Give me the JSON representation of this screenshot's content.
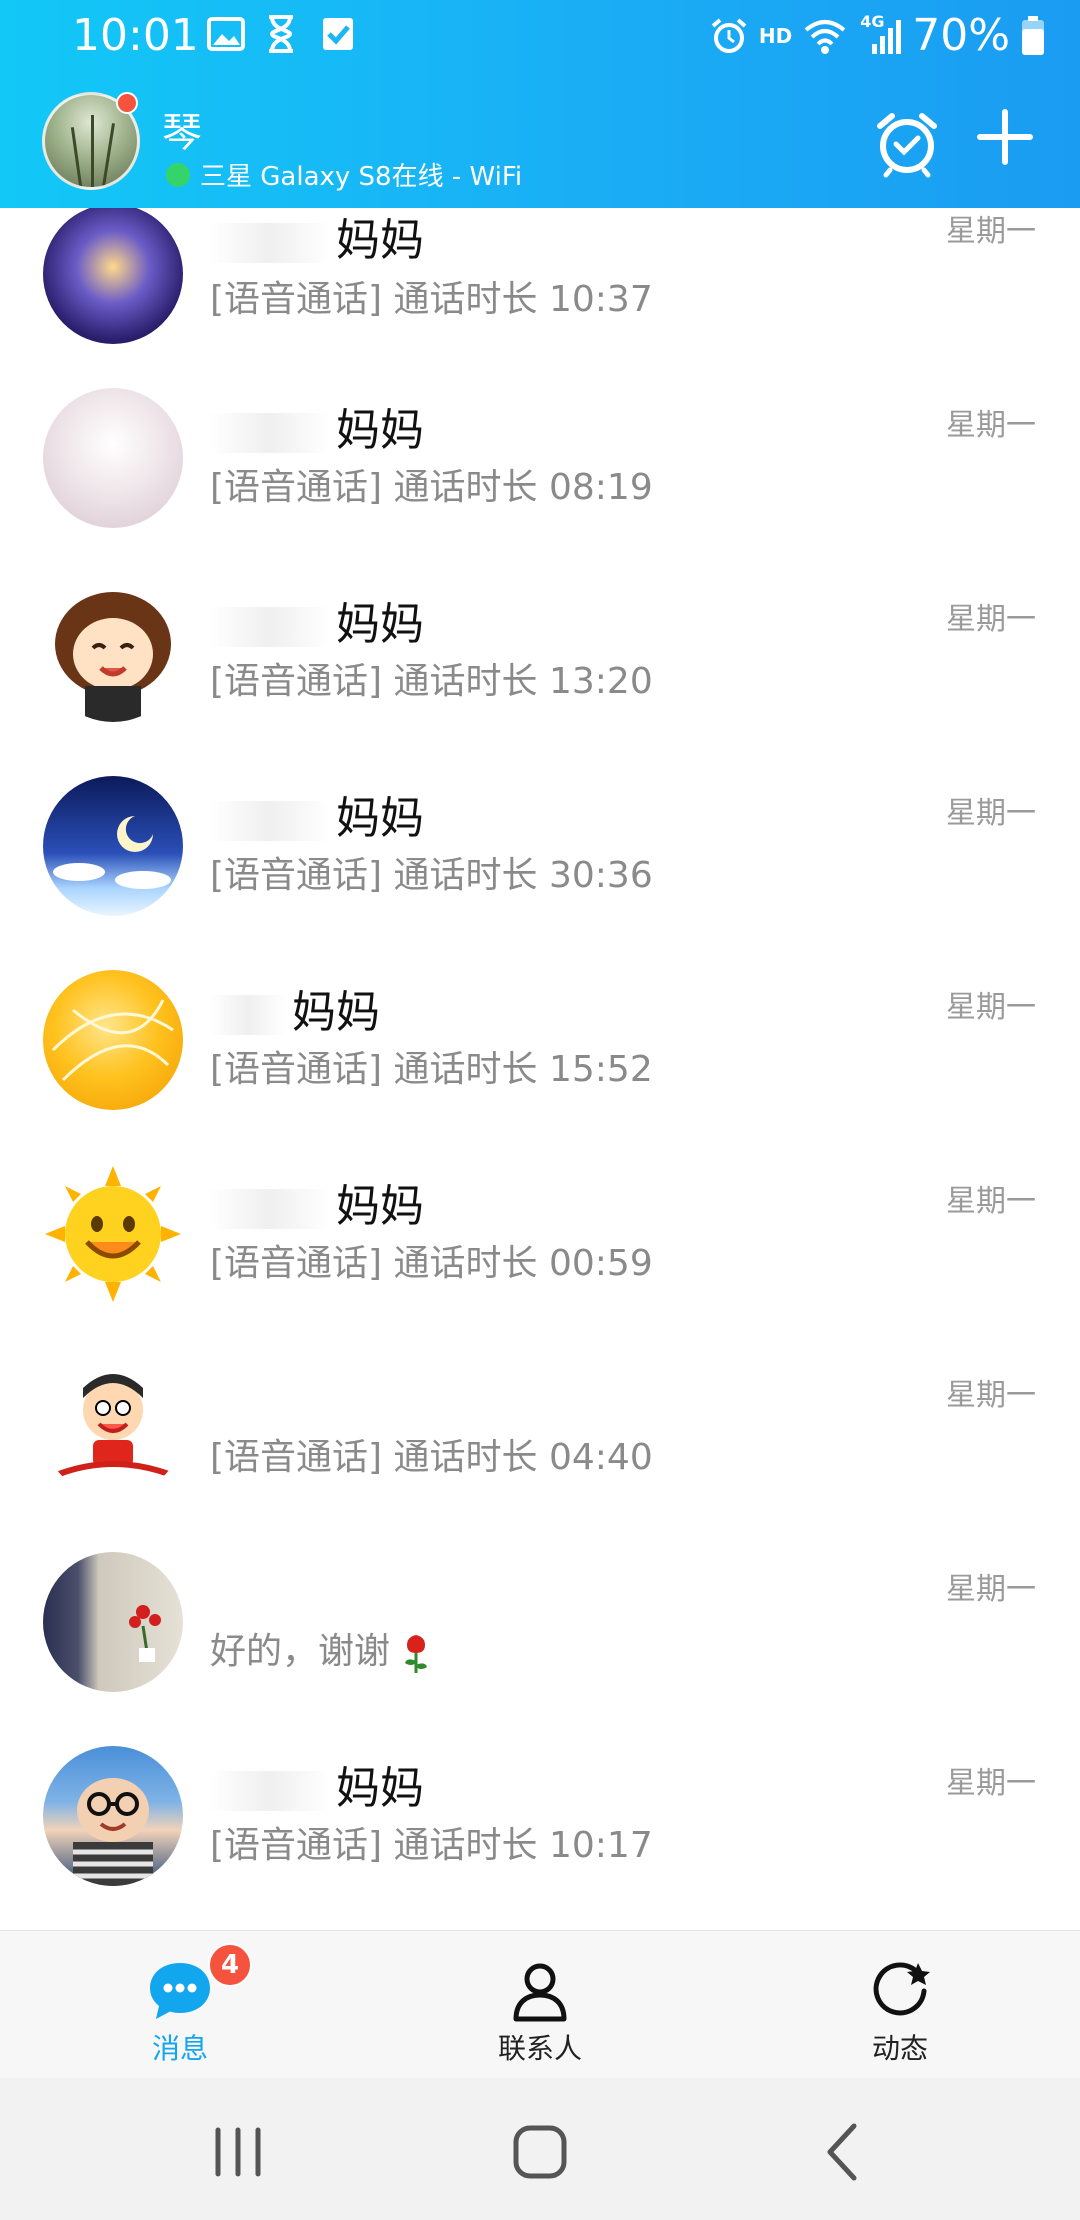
{
  "status_bar": {
    "time": "10:01",
    "hd_label": "HD",
    "network_label": "4G",
    "battery": "70%"
  },
  "profile": {
    "name": "琴",
    "status": "三星 Galaxy S8在线 - WiFi",
    "notification_dot_color": "#f5533d",
    "online_color": "#35d46a"
  },
  "header_icons": [
    "alarm-clock-icon",
    "add-icon"
  ],
  "conversations": [
    {
      "name": "妈妈",
      "preview": "[语音通话] 通话时长 10:37",
      "time": "星期一"
    },
    {
      "name": "妈妈",
      "preview": "[语音通话] 通话时长 08:19",
      "time": "星期一"
    },
    {
      "name": "妈妈",
      "preview": "[语音通话] 通话时长 13:20",
      "time": "星期一"
    },
    {
      "name": "妈妈",
      "preview": "[语音通话] 通话时长 30:36",
      "time": "星期一"
    },
    {
      "name": "妈妈",
      "preview": "[语音通话] 通话时长 15:52",
      "time": "星期一"
    },
    {
      "name": "妈妈",
      "preview": "[语音通话] 通话时长 00:59",
      "time": "星期一"
    },
    {
      "name": "",
      "preview": "[语音通话] 通话时长 04:40",
      "time": "星期一"
    },
    {
      "name": "",
      "preview": "好的，谢谢",
      "time": "星期一"
    },
    {
      "name": "妈妈",
      "preview": "[语音通话] 通话时长 10:17",
      "time": "星期一"
    }
  ],
  "tabs": [
    {
      "label": "消息",
      "icon": "chat-bubble-icon",
      "badge": "4",
      "active": true
    },
    {
      "label": "联系人",
      "icon": "person-icon",
      "active": false
    },
    {
      "label": "动态",
      "icon": "refresh-star-icon",
      "active": false
    }
  ],
  "colors": {
    "header_gradient_start": "#12c8f7",
    "header_gradient_end": "#1a9cf2",
    "active_tab": "#12a6ef",
    "badge": "#f5533d"
  },
  "nav_icons": [
    "recent-apps-icon",
    "home-icon",
    "back-icon"
  ]
}
